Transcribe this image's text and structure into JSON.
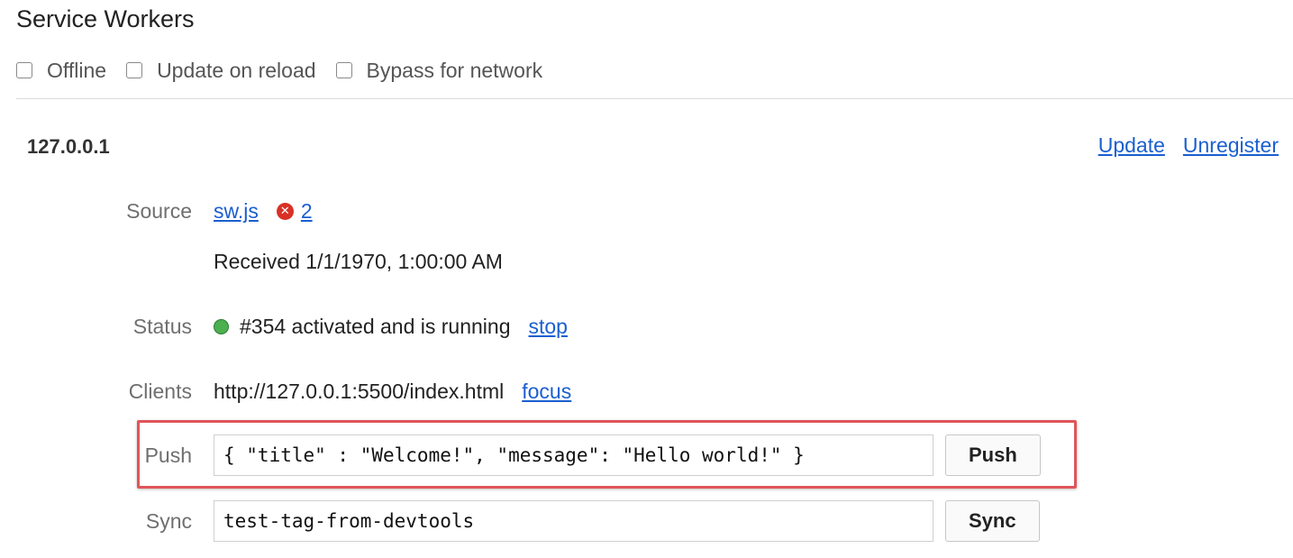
{
  "panel": {
    "title": "Service Workers"
  },
  "options": [
    {
      "label": "Offline",
      "checked": false
    },
    {
      "label": "Update on reload",
      "checked": false
    },
    {
      "label": "Bypass for network",
      "checked": false
    }
  ],
  "worker": {
    "origin": "127.0.0.1",
    "actions": {
      "update": "Update",
      "unregister": "Unregister"
    },
    "source": {
      "label": "Source",
      "file": "sw.js",
      "error_count": "2",
      "error_icon": "error-icon",
      "received": "Received 1/1/1970, 1:00:00 AM"
    },
    "status": {
      "label": "Status",
      "text": "#354 activated and is running",
      "link": "stop",
      "color": "#4caf50"
    },
    "clients": {
      "label": "Clients",
      "url": "http://127.0.0.1:5500/index.html",
      "link": "focus"
    },
    "push": {
      "label": "Push",
      "value": "{ \"title\" : \"Welcome!\", \"message\": \"Hello world!\" }",
      "button": "Push"
    },
    "sync": {
      "label": "Sync",
      "value": "test-tag-from-devtools",
      "button": "Sync"
    }
  },
  "colors": {
    "link": "#1a5fd0",
    "highlight": "#e0555a",
    "error": "#d93025"
  }
}
